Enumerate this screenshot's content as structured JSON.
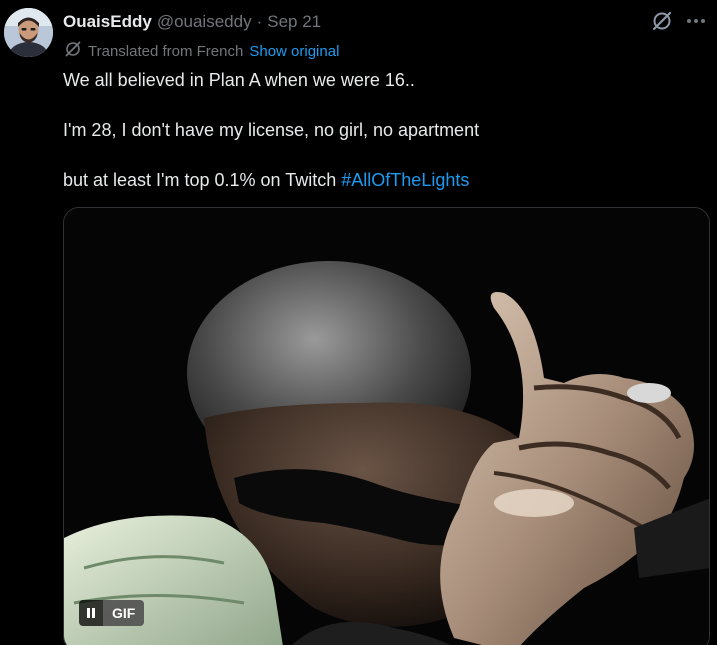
{
  "author": {
    "display_name": "OuaisEddy",
    "handle": "@ouaiseddy",
    "separator": "·",
    "date": "Sep 21"
  },
  "translation": {
    "label": "Translated from French",
    "show_original": "Show original"
  },
  "tweet": {
    "line1": "We all believed in Plan A when we were 16..",
    "line2": "I'm 28, I don't have my license, no girl, no apartment",
    "line3_prefix": "but at least I'm top 0.1% on Twitch",
    "hashtag": "#AllOfTheLights"
  },
  "media": {
    "badge": "GIF",
    "pause_icon": "pause-icon"
  },
  "icons": {
    "grok": "grok-icon",
    "more": "more-icon",
    "translate": "translate-icon"
  },
  "colors": {
    "background": "#000000",
    "text": "#e7e9ea",
    "muted": "#71767b",
    "link": "#1d9bf0",
    "border": "#2f3336"
  }
}
